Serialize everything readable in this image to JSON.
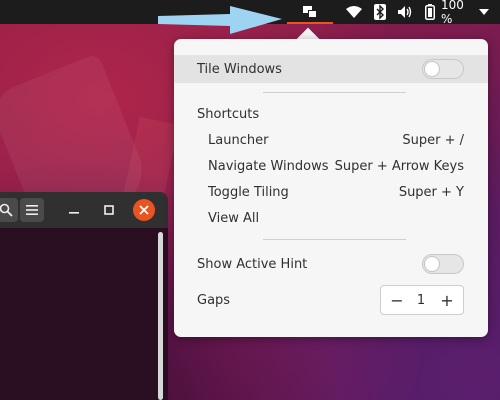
{
  "topbar": {
    "tiling_icon": "tiling-windows-icon",
    "wifi_icon": "wifi-icon",
    "bluetooth_icon": "bluetooth-icon",
    "volume_icon": "volume-icon",
    "battery_icon": "battery-icon",
    "battery_percent": "100 %",
    "caret_icon": "chevron-down-icon",
    "accent_color": "#e95420"
  },
  "window": {
    "search_icon": "search-icon",
    "menu_icon": "hamburger-menu-icon",
    "minimize_label": "–",
    "maximize_icon": "maximize-icon",
    "close_icon": "close-icon"
  },
  "menu": {
    "tile_windows": {
      "label": "Tile Windows",
      "on": false
    },
    "shortcuts_header": "Shortcuts",
    "shortcuts": [
      {
        "label": "Launcher",
        "keys": "Super + /"
      },
      {
        "label": "Navigate Windows",
        "keys": "Super + Arrow Keys"
      },
      {
        "label": "Toggle Tiling",
        "keys": "Super + Y"
      }
    ],
    "view_all": "View All",
    "show_active_hint": {
      "label": "Show Active Hint",
      "on": false
    },
    "gaps": {
      "label": "Gaps",
      "value": "1",
      "minus": "−",
      "plus": "+"
    }
  }
}
